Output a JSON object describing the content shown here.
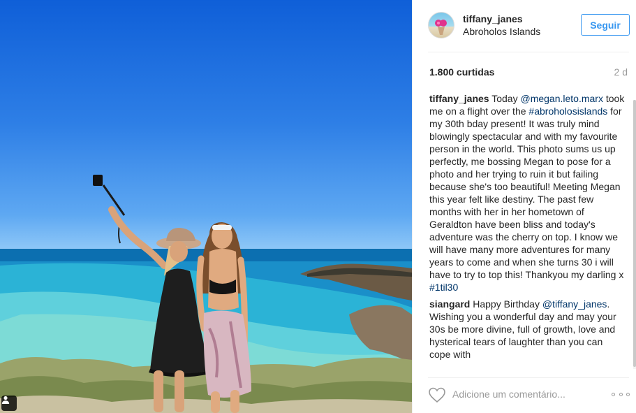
{
  "post": {
    "username": "tiffany_janes",
    "location": "Abroholos Islands",
    "follow_label": "Seguir",
    "likes": "1.800 curtidas",
    "time": "2 d"
  },
  "comments": [
    {
      "user": "tiffany_janes",
      "parts": [
        {
          "text": " Today ",
          "link": false
        },
        {
          "text": "@megan.leto.marx",
          "link": true
        },
        {
          "text": " took me on a flight over the ",
          "link": false
        },
        {
          "text": "#abroholosislands",
          "link": true
        },
        {
          "text": " for my 30th bday present! It was truly mind blowingly spectacular and with my favourite person in the world. This photo sums us up perfectly, me bossing Megan to pose for a photo and her trying to ruin it but failing because she's too beautiful! Meeting Megan this year felt like destiny. The past few months with her in her hometown of Geraldton have been bliss and today's adventure was the cherry on top. I know we will have many more adventures for many years to come and when she turns 30 i will have to try to top this! Thankyou my darling x ",
          "link": false
        },
        {
          "text": "#1til30",
          "link": true
        }
      ]
    },
    {
      "user": "siangard",
      "parts": [
        {
          "text": " Happy Birthday ",
          "link": false
        },
        {
          "text": "@tiffany_janes",
          "link": true
        },
        {
          "text": ". Wishing you a wonderful day and may your 30s be more divine, full of growth, love and hysterical tears of laughter than you can cope with",
          "link": false
        }
      ]
    }
  ],
  "comment_input": {
    "placeholder": "Adicione um comentário..."
  },
  "icons": {
    "like": "heart-icon",
    "more": "more-options-icon",
    "user_tag": "user-tag-icon"
  },
  "colors": {
    "link": "#003569",
    "follow": "#3897f0",
    "muted": "#999999"
  }
}
